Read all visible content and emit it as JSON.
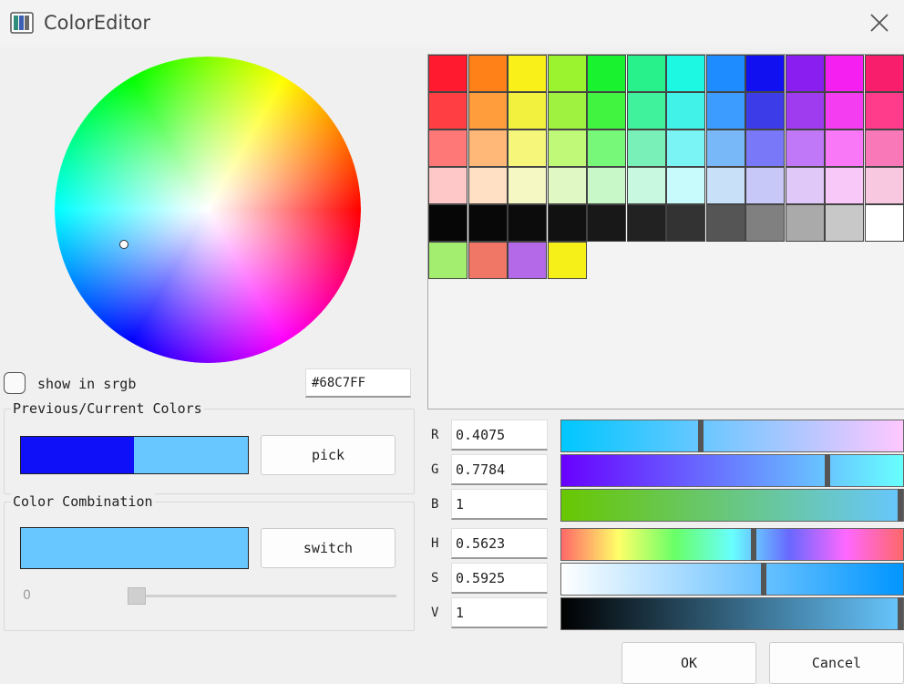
{
  "window": {
    "title": "ColorEditor",
    "icon": "app-icon",
    "close_icon": "close-icon"
  },
  "wheel": {
    "marker": "selected-color-marker"
  },
  "srgb": {
    "label": "show in srgb",
    "checked": false
  },
  "hex": {
    "value": "#68C7FF"
  },
  "previous_current": {
    "title": "Previous/Current Colors",
    "previous_color": "#1010F8",
    "current_color": "#68C7FF",
    "pick_label": "pick"
  },
  "combination": {
    "title": "Color Combination",
    "color": "#68C7FF",
    "switch_label": "switch",
    "slider_value": "0"
  },
  "palette": {
    "rows": [
      [
        "#ff1a30",
        "#ff8118",
        "#f8f018",
        "#9bf22f",
        "#18f22f",
        "#28f08a",
        "#1cf8e2",
        "#1e8cff",
        "#1010f0",
        "#8a1ef0",
        "#f41ff0",
        "#f81e6c"
      ],
      [
        "#ff3e44",
        "#ff9c3c",
        "#f2f23e",
        "#a0f240",
        "#40f440",
        "#40f29c",
        "#40f2e8",
        "#3c9cff",
        "#3c3ce8",
        "#a03cf0",
        "#f43cf0",
        "#ff3c8c"
      ],
      [
        "#ff7878",
        "#ffb878",
        "#f6f67a",
        "#c0f878",
        "#78f878",
        "#78f0b8",
        "#7af4f4",
        "#78b8f8",
        "#7878f8",
        "#c078f8",
        "#f878f8",
        "#f878b8"
      ],
      [
        "#ffc8c8",
        "#ffe0c4",
        "#f6f8c4",
        "#e0f8c4",
        "#c8f8c8",
        "#c8f8e0",
        "#c8fcfc",
        "#c8e0f8",
        "#c8c8f8",
        "#e0c8f8",
        "#f8c8f8",
        "#f8c8e0"
      ],
      [
        "#060606",
        "#080808",
        "#0c0c0c",
        "#111111",
        "#181818",
        "#222222",
        "#333333",
        "#555555",
        "#808080",
        "#aaaaaa",
        "#c8c8c8",
        "#ffffff"
      ],
      [
        "#a3ee6e",
        "#f07666",
        "#b46ae8",
        "#f6f018"
      ]
    ]
  },
  "channels": [
    {
      "key": "R",
      "label": "R",
      "value": "0.4075",
      "position": 0.4075,
      "gradient": "linear-gradient(90deg,#00c7ff,#ffc7ff)"
    },
    {
      "key": "G",
      "label": "G",
      "value": "0.7784",
      "position": 0.7784,
      "gradient": "linear-gradient(90deg,#6800ff,#68ffff)"
    },
    {
      "key": "B",
      "label": "B",
      "value": "1",
      "position": 1,
      "gradient": "linear-gradient(90deg,#68c700,#68c7ff)"
    },
    {
      "key": "H",
      "label": "H",
      "value": "0.5623",
      "position": 0.5623,
      "gradient": "linear-gradient(90deg,#ff6868,#ffff68,#68ff68,#68ffff,#6868ff,#ff68ff,#ff6868)"
    },
    {
      "key": "S",
      "label": "S",
      "value": "0.5925",
      "position": 0.5925,
      "gradient": "linear-gradient(90deg,#ffffff,#0096ff)"
    },
    {
      "key": "V",
      "label": "V",
      "value": "1",
      "position": 1,
      "gradient": "linear-gradient(90deg,#000000,#68c7ff)"
    }
  ],
  "buttons": {
    "ok": "OK",
    "cancel": "Cancel"
  }
}
